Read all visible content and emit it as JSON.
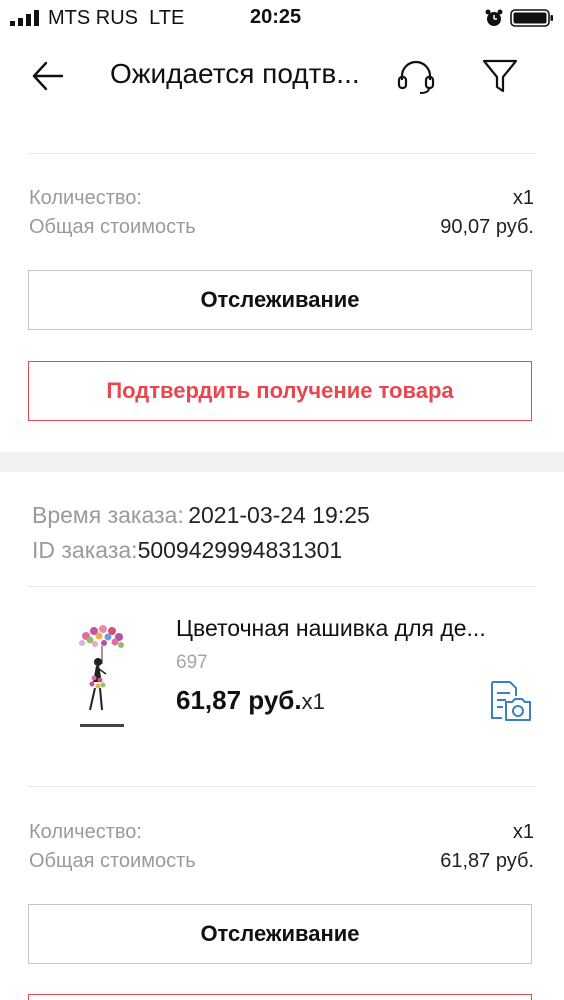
{
  "status_bar": {
    "carrier": "MTS RUS",
    "network": "LTE",
    "time": "20:25"
  },
  "header": {
    "title": "Ожидается подтв...",
    "icons": [
      "back-arrow-icon",
      "headset-icon",
      "filter-icon"
    ]
  },
  "order1": {
    "quantity_label": "Количество:",
    "quantity_value": "x1",
    "total_label": "Общая стоимость",
    "total_value": "90,07 руб.",
    "track_button": "Отслеживание",
    "confirm_button": "Подтвердить получение товара"
  },
  "order2": {
    "time_label": "Время заказа:",
    "time_value": "2021-03-24 19:25",
    "id_label": "ID заказа:",
    "id_value": "5009429994831301",
    "product": {
      "title": "Цветочная нашивка для де...",
      "sku": "697",
      "price": "61,87 руб.",
      "qty": "x1"
    },
    "quantity_label": "Количество:",
    "quantity_value": "x1",
    "total_label": "Общая стоимость",
    "total_value": "61,87 руб.",
    "track_button": "Отслеживание"
  },
  "colors": {
    "accent_red": "#e8474f",
    "icon_blue": "#3b7fc4",
    "muted_text": "#9a9a9a"
  }
}
